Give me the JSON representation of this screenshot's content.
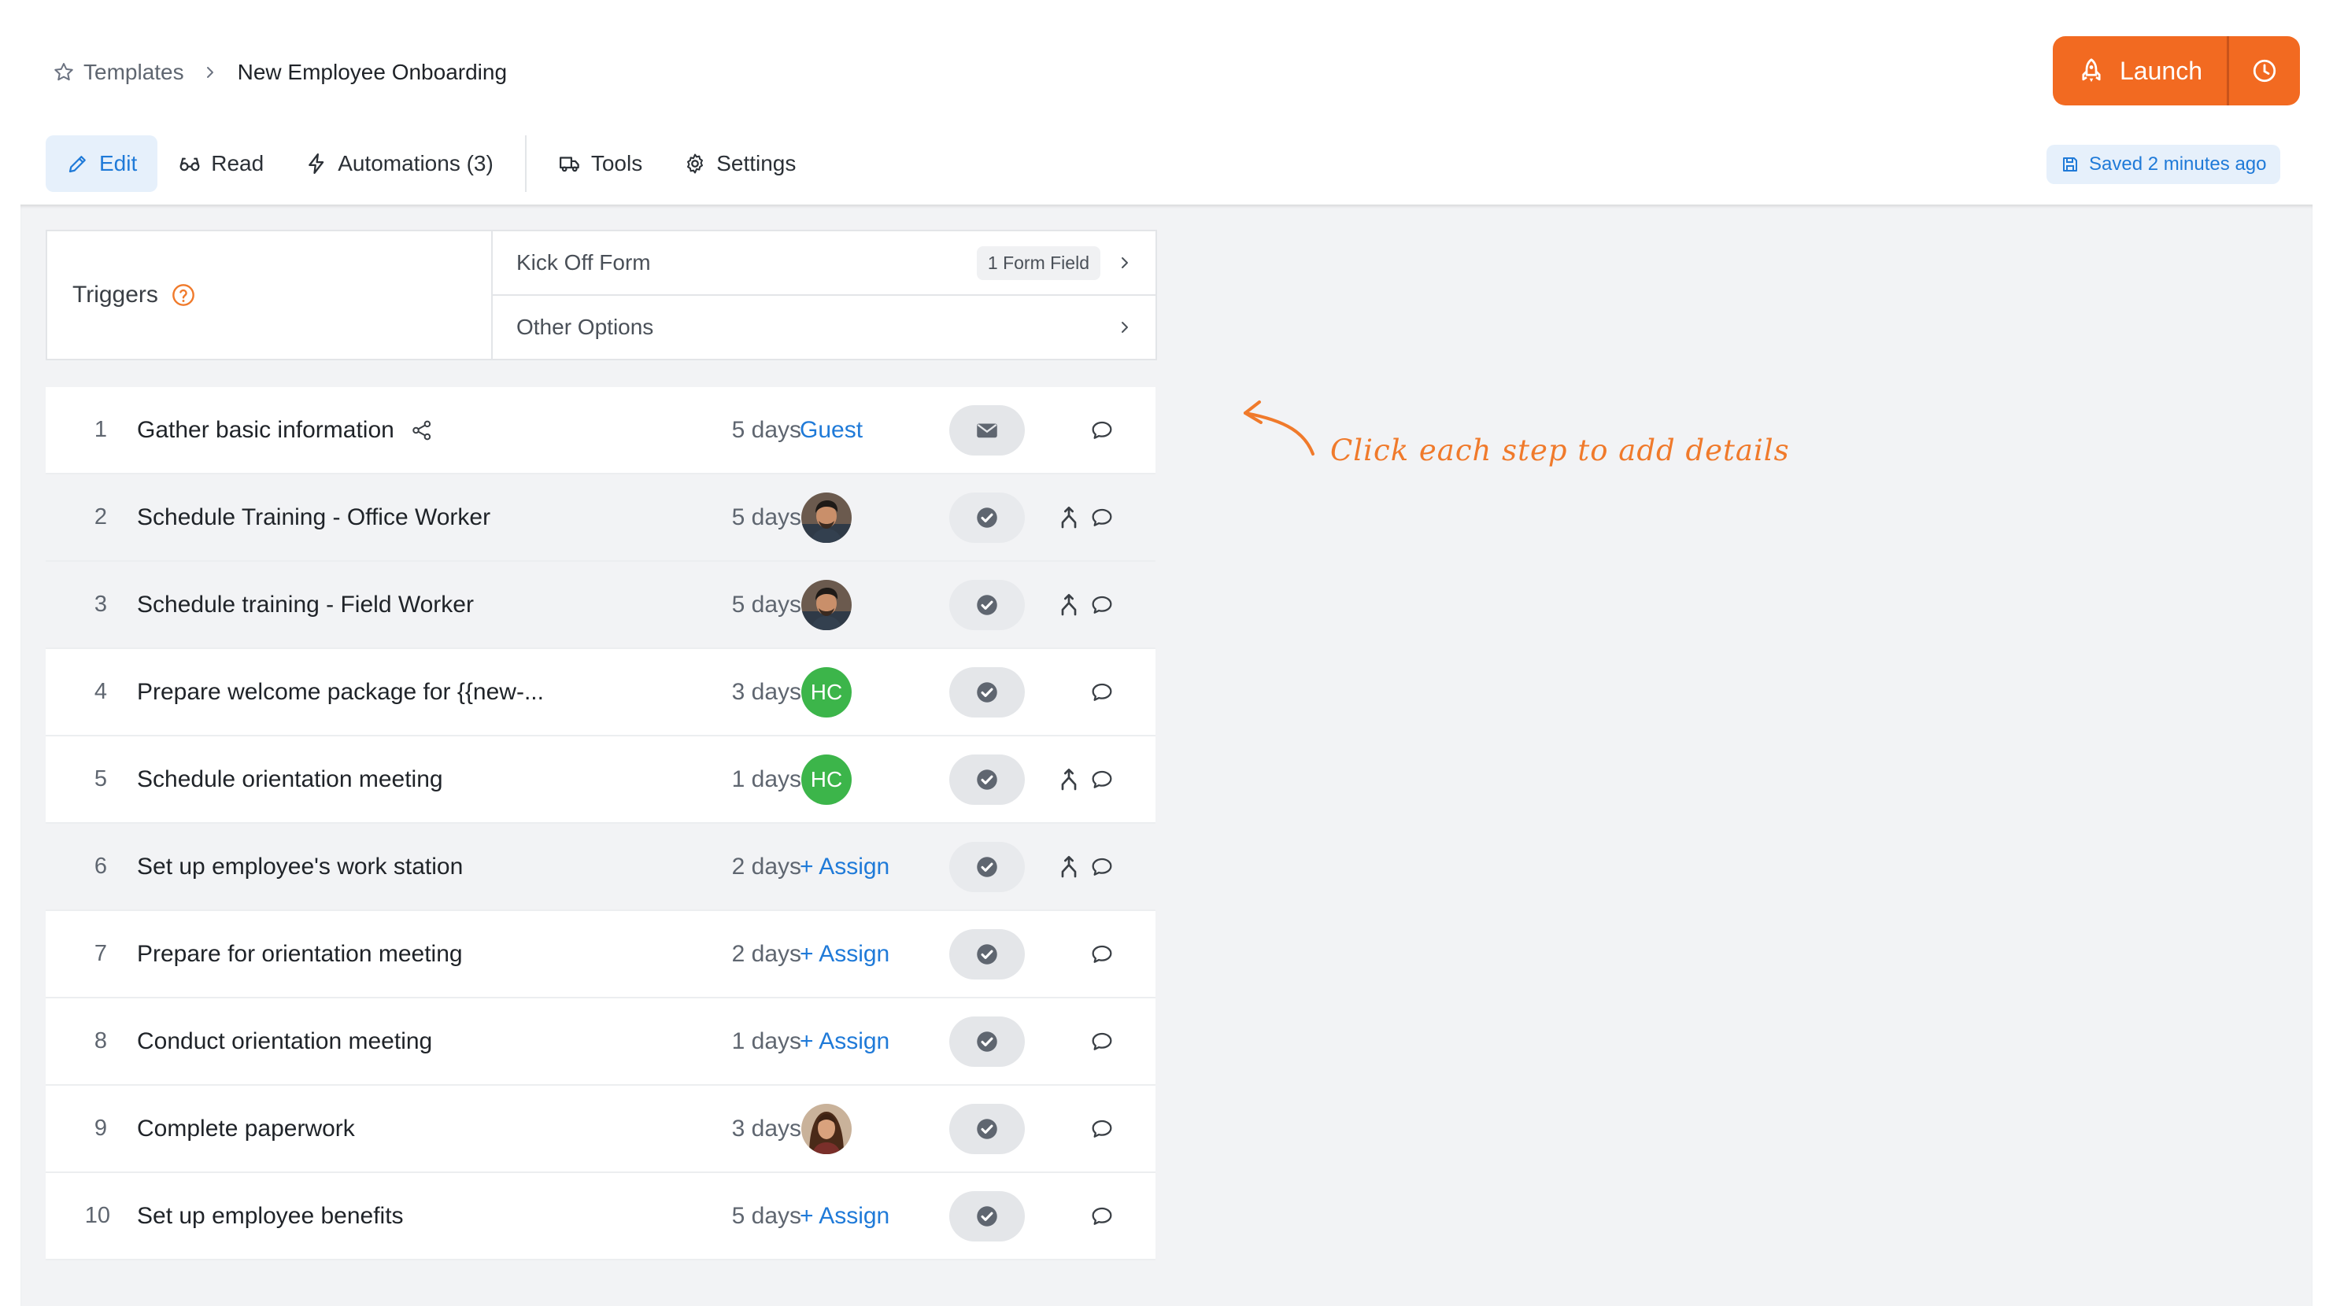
{
  "breadcrumb": {
    "root": "Templates",
    "current": "New Employee Onboarding"
  },
  "launch": {
    "label": "Launch"
  },
  "tabs": [
    {
      "label": "Edit",
      "icon": "pencil-icon",
      "active": true
    },
    {
      "label": "Read",
      "icon": "glasses-icon"
    },
    {
      "label": "Automations (3)",
      "icon": "lightning-icon"
    },
    {
      "label": "Tools",
      "icon": "truck-icon"
    },
    {
      "label": "Settings",
      "icon": "gear-icon"
    }
  ],
  "saved": {
    "label": "Saved 2 minutes ago"
  },
  "triggers": {
    "title": "Triggers",
    "rows": [
      {
        "label": "Kick Off Form",
        "badge": "1 Form Field"
      },
      {
        "label": "Other Options"
      }
    ]
  },
  "steps": [
    {
      "num": "1",
      "title": "Gather basic information",
      "duration": "5 days",
      "assignee_type": "text",
      "assignee_text": "Guest",
      "action": "email",
      "has_branch": false,
      "has_share": true
    },
    {
      "num": "2",
      "title": "Schedule Training - Office Worker",
      "duration": "5 days",
      "assignee_type": "avatar",
      "action": "check",
      "has_branch": true
    },
    {
      "num": "3",
      "title": "Schedule training - Field Worker",
      "duration": "5 days",
      "assignee_type": "avatar",
      "action": "check",
      "has_branch": true
    },
    {
      "num": "4",
      "title": "Prepare welcome package for {{new-...",
      "duration": "3 days",
      "assignee_type": "initials",
      "assignee_text": "HC",
      "action": "check",
      "has_branch": false
    },
    {
      "num": "5",
      "title": "Schedule orientation meeting",
      "duration": "1 days",
      "assignee_type": "initials",
      "assignee_text": "HC",
      "action": "check",
      "has_branch": true
    },
    {
      "num": "6",
      "title": "Set up employee's work station",
      "duration": "2 days",
      "assignee_type": "assign",
      "assignee_text": "+ Assign",
      "action": "check",
      "has_branch": true
    },
    {
      "num": "7",
      "title": "Prepare for orientation meeting",
      "duration": "2 days",
      "assignee_type": "assign",
      "assignee_text": "+ Assign",
      "action": "check",
      "has_branch": false
    },
    {
      "num": "8",
      "title": "Conduct orientation meeting",
      "duration": "1 days",
      "assignee_type": "assign",
      "assignee_text": "+ Assign",
      "action": "check",
      "has_branch": false
    },
    {
      "num": "9",
      "title": "Complete paperwork",
      "duration": "3 days",
      "assignee_type": "avatar-female",
      "action": "check",
      "has_branch": false
    },
    {
      "num": "10",
      "title": "Set up employee benefits",
      "duration": "5 days",
      "assignee_type": "assign",
      "assignee_text": "+ Assign",
      "action": "check",
      "has_branch": false
    }
  ],
  "hint": {
    "text": "Click each step to add details"
  },
  "colors": {
    "accent": "#1f7ad8",
    "launch": "#f26a21",
    "hint": "#f07a2b",
    "initials_avatar": "#3cb54a"
  }
}
